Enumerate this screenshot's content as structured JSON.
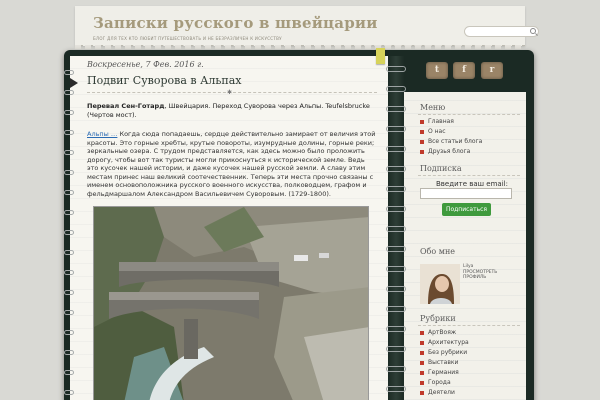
{
  "header": {
    "title": "Записки русского в швейцарии",
    "tagline": "БЛОГ ДЛЯ ТЕХ КТО ЛЮБИТ ПУТЕШЕСТВОВАТЬ И НЕ БЕЗРАЗЛИЧЕН К ИСКУССТВУ"
  },
  "post": {
    "date": "Воскресенье, 7 Фев. 2016 г.",
    "title": "Подвиг Суворова в Альпах",
    "lead_bold": "Перевал Сен-Готард",
    "lead_rest": ", Швейцария. Переход Суворова через Альпы. Teufelsbrucke (Чертов мост).",
    "body_link": "Альпы …",
    "body": " Когда сюда попадаешь, сердце действительно замирает от величия этой красоты. Это горные хребты, крутые повороты, изумрудные долины, горные реки; зеркальные озера. С трудом представляется, как здесь можно было проложить дорогу, чтобы вот так туристы могли прикоснуться к исторической земле. Ведь это кусочек нашей истории, и даже кусочек нашей русской земли. А славу этим местам принес наш великий соотечественник. Теперь эти места прочно связаны с именем основоположника русского военного искусства, полководцем, графом и фельдмаршалом Александром Васильевичем Суворовым. (1729-1800)."
  },
  "social": {
    "twitter": "t",
    "facebook": "f",
    "rss": "r"
  },
  "sidebar": {
    "menu_title": "Меню",
    "menu_items": [
      "Главная",
      "О нас",
      "Все статьи блога",
      "Друзья блога"
    ],
    "subscribe_title": "Подписка",
    "email_label": "Введите ваш email:",
    "subscribe_button": "Подписаться",
    "about_title": "Обо мне",
    "about_name": "Lilya",
    "about_link": "ПРОСМОТРЕТЬ ПРОФИЛЬ",
    "rubrics_title": "Рубрики",
    "rubrics": [
      "АртВояж",
      "Архитектура",
      "Без рубрики",
      "Выставки",
      "Германия",
      "Города",
      "Деятели"
    ]
  },
  "colors": {
    "notebook": "#1b2a24",
    "title": "#a59a7c",
    "link": "#2a6bb3",
    "bullet": "#c03a2b",
    "button": "#3f9a3d"
  }
}
